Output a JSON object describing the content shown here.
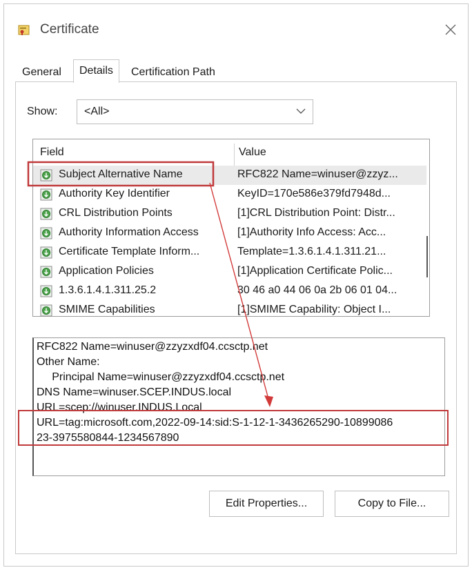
{
  "window": {
    "title": "Certificate"
  },
  "tabs": [
    {
      "label": "General"
    },
    {
      "label": "Details"
    },
    {
      "label": "Certification Path"
    }
  ],
  "show": {
    "label": "Show:",
    "value": "<All>"
  },
  "table": {
    "headers": {
      "field": "Field",
      "value": "Value"
    },
    "rows": [
      {
        "field": "Subject Alternative Name",
        "value": "RFC822 Name=winuser@zzyz..."
      },
      {
        "field": "Authority Key Identifier",
        "value": "KeyID=170e586e379fd7948d..."
      },
      {
        "field": "CRL Distribution Points",
        "value": "[1]CRL Distribution Point: Distr..."
      },
      {
        "field": "Authority Information Access",
        "value": "[1]Authority Info Access: Acc..."
      },
      {
        "field": "Certificate Template Inform...",
        "value": "Template=1.3.6.1.4.1.311.21..."
      },
      {
        "field": "Application Policies",
        "value": "[1]Application Certificate Polic..."
      },
      {
        "field": "1.3.6.1.4.1.311.25.2",
        "value": "30 46 a0 44 06 0a 2b 06 01 04..."
      },
      {
        "field": "SMIME Capabilities",
        "value": "[1]SMIME Capability: Object I..."
      }
    ]
  },
  "details": {
    "lines": [
      "RFC822 Name=winuser@zzyzxdf04.ccsctp.net",
      "Other Name:",
      "     Principal Name=winuser@zzyzxdf04.ccsctp.net",
      "DNS Name=winuser.SCEP.INDUS.local",
      "URL=scep://winuser.INDUS.Local",
      "URL=tag:microsoft.com,2022-09-14:sid:S-1-12-1-3436265290-10899086",
      "23-3975580844-1234567890"
    ]
  },
  "buttons": {
    "edit": "Edit Properties...",
    "copy": "Copy to File..."
  },
  "colors": {
    "highlight_box": "#c0393b",
    "arrow": "#d23a3a",
    "icon_green": "#3a9a3a"
  }
}
